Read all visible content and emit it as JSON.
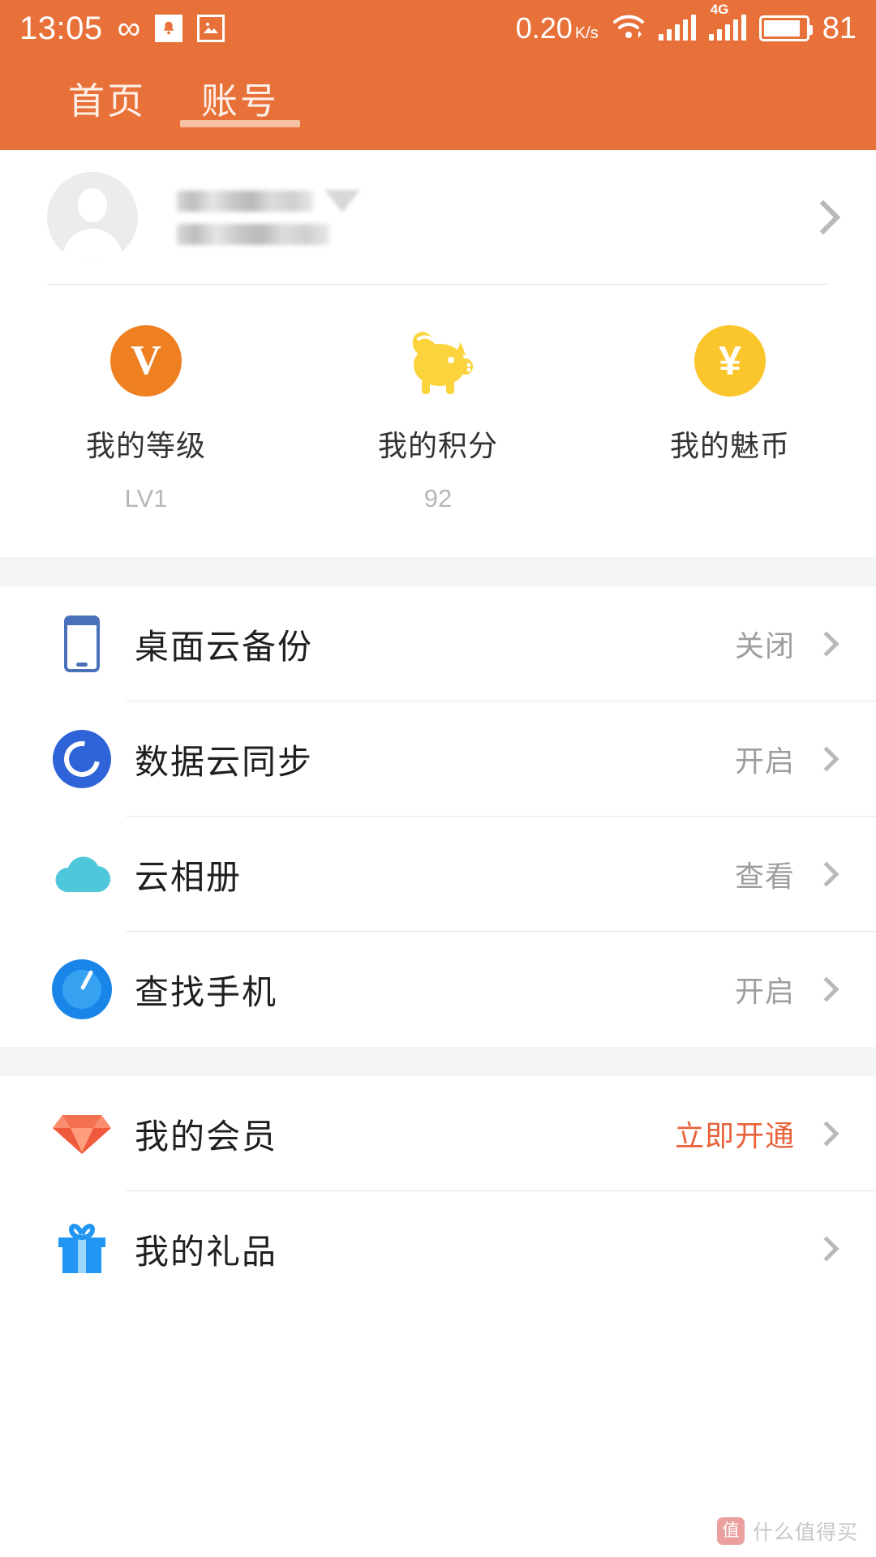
{
  "status_bar": {
    "time": "13:05",
    "network_speed": "0.20",
    "network_speed_unit": "K/s",
    "battery_percent": "81",
    "network_type": "4G",
    "icons": [
      "infinity-icon",
      "notification-icon",
      "gallery-icon",
      "wifi-icon",
      "signal-icon",
      "signal-icon-2",
      "battery-icon"
    ],
    "bg_color": "#e8713a"
  },
  "tabs": [
    {
      "label": "首页",
      "active": false
    },
    {
      "label": "账号",
      "active": true
    }
  ],
  "profile": {
    "avatar_icon": "default-avatar-icon",
    "name_masked": true,
    "badge_icon": "diamond-badge-icon",
    "chevron_icon": "chevron-right-icon"
  },
  "stats": [
    {
      "icon": "v-level-badge-icon",
      "label": "我的等级",
      "value": "LV1",
      "color": "#ef8022"
    },
    {
      "icon": "piggy-bank-icon",
      "label": "我的积分",
      "value": "92",
      "color": "#fbc52c"
    },
    {
      "icon": "yuan-coin-icon",
      "label": "我的魅币",
      "value": "",
      "color": "#fbc52c"
    }
  ],
  "menu_groups": [
    {
      "rows": [
        {
          "icon": "phone-icon",
          "label": "桌面云备份",
          "value": "关闭",
          "accent": false
        },
        {
          "icon": "sync-icon",
          "label": "数据云同步",
          "value": "开启",
          "accent": false
        },
        {
          "icon": "cloud-icon",
          "label": "云相册",
          "value": "查看",
          "accent": false
        },
        {
          "icon": "compass-icon",
          "label": "查找手机",
          "value": "开启",
          "accent": false
        }
      ]
    },
    {
      "rows": [
        {
          "icon": "diamond-icon",
          "label": "我的会员",
          "value": "立即开通",
          "accent": true
        },
        {
          "icon": "gift-icon",
          "label": "我的礼品",
          "value": "",
          "accent": false
        }
      ]
    }
  ],
  "watermark": {
    "badge": "值",
    "text": "什么值得买"
  },
  "colors": {
    "brand_orange": "#e8713a",
    "accent_orange": "#e8623a",
    "text_primary": "#1f1f1f",
    "text_secondary": "#9e9e9e",
    "divider": "#e6e6e6",
    "section_gap": "#f3f4f5"
  }
}
